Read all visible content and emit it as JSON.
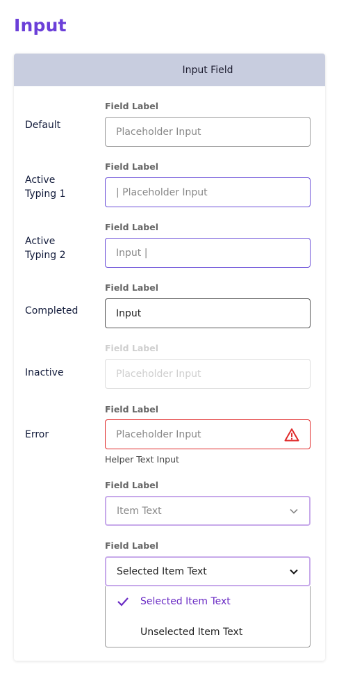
{
  "page": {
    "title": "Input"
  },
  "card": {
    "header": "Input Field"
  },
  "states": [
    {
      "label": "Default",
      "field_label": "Field Label",
      "value": "Placeholder Input"
    },
    {
      "label": "Active\nTyping 1",
      "field_label": "Field Label",
      "value": "| Placeholder Input"
    },
    {
      "label": "Active\nTyping 2",
      "field_label": "Field Label",
      "value": "Input |"
    },
    {
      "label": "Completed",
      "field_label": "Field Label",
      "value": "Input"
    },
    {
      "label": "Inactive",
      "field_label": "Field Label",
      "value": "Placeholder Input"
    },
    {
      "label": "Error",
      "field_label": "Field Label",
      "value": "Placeholder Input",
      "helper": "Helper Text Input",
      "icon": "warning-icon"
    }
  ],
  "select": {
    "field_label": "Field Label",
    "value": "Item Text",
    "icon": "chevron-down-icon"
  },
  "select_open": {
    "field_label": "Field Label",
    "value": "Selected Item Text",
    "icon": "chevron-down-icon",
    "options": [
      {
        "label": "Selected Item Text",
        "selected": true,
        "icon": "check-icon"
      },
      {
        "label": "Unselected Item Text",
        "selected": false
      }
    ]
  },
  "colors": {
    "accent": "#6b3fd8",
    "active_border": "#6b4fd8",
    "error": "#e02a2a",
    "select_border": "#c7a9ea",
    "header_bg": "#c8cddf"
  }
}
